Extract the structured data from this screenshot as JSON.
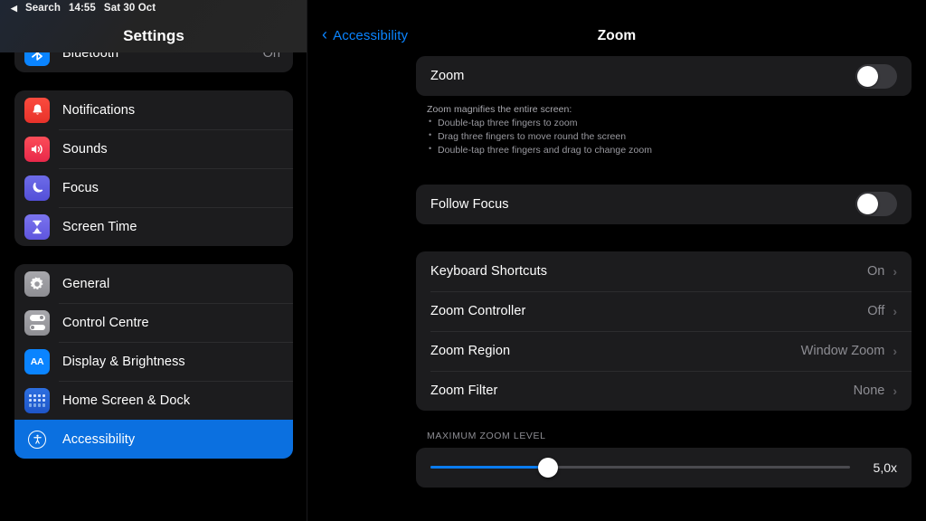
{
  "statusbar": {
    "back_arrow": "◀",
    "back_label": "Search",
    "time": "14:55",
    "date": "Sat 30 Oct"
  },
  "sidebar": {
    "title": "Settings",
    "groups": [
      {
        "clipped": true,
        "items": [
          {
            "label": "Bluetooth",
            "value": "On",
            "icon": "bluetooth-icon",
            "glyph": "ᛗ"
          }
        ]
      },
      {
        "clipped": false,
        "items": [
          {
            "label": "Notifications",
            "value": "",
            "icon": "notifications-icon",
            "glyph": "🔔"
          },
          {
            "label": "Sounds",
            "value": "",
            "icon": "sounds-icon",
            "glyph": "🔊"
          },
          {
            "label": "Focus",
            "value": "",
            "icon": "focus-icon",
            "glyph": "☽"
          },
          {
            "label": "Screen Time",
            "value": "",
            "icon": "screen-time-icon",
            "glyph": "⌛"
          }
        ]
      },
      {
        "clipped": false,
        "items": [
          {
            "label": "General",
            "value": "",
            "icon": "gear-icon",
            "glyph": "⚙"
          },
          {
            "label": "Control Centre",
            "value": "",
            "icon": "control-centre-icon",
            "glyph": ""
          },
          {
            "label": "Display & Brightness",
            "value": "",
            "icon": "display-brightness-icon",
            "glyph": "AA"
          },
          {
            "label": "Home Screen & Dock",
            "value": "",
            "icon": "home-screen-dock-icon",
            "glyph": ""
          },
          {
            "label": "Accessibility",
            "value": "",
            "icon": "accessibility-icon",
            "glyph": "Ł",
            "selected": true
          }
        ]
      }
    ]
  },
  "content": {
    "back_label": "Accessibility",
    "back_chevron": "‹",
    "title": "Zoom",
    "zoom_row": {
      "label": "Zoom",
      "state": "off"
    },
    "footnote": {
      "lead": "Zoom magnifies the entire screen:",
      "bullets": [
        "Double-tap three fingers to zoom",
        "Drag three fingers to move round the screen",
        "Double-tap three fingers and drag to change zoom"
      ]
    },
    "follow_focus_row": {
      "label": "Follow Focus",
      "state": "off"
    },
    "options": [
      {
        "label": "Keyboard Shortcuts",
        "value": "On",
        "chevron": "›"
      },
      {
        "label": "Zoom Controller",
        "value": "Off",
        "chevron": "›"
      },
      {
        "label": "Zoom Region",
        "value": "Window Zoom",
        "chevron": "›"
      },
      {
        "label": "Zoom Filter",
        "value": "None",
        "chevron": "›"
      }
    ],
    "max_zoom": {
      "section_header": "MAXIMUM ZOOM LEVEL",
      "value_label": "5,0x",
      "percent": 28
    }
  },
  "colors": {
    "accent_blue": "#0a84ff",
    "selection_blue": "#0b70e0",
    "card_bg": "#1c1c1e",
    "page_bg": "#000000",
    "secondary_text": "#8d8d93"
  }
}
